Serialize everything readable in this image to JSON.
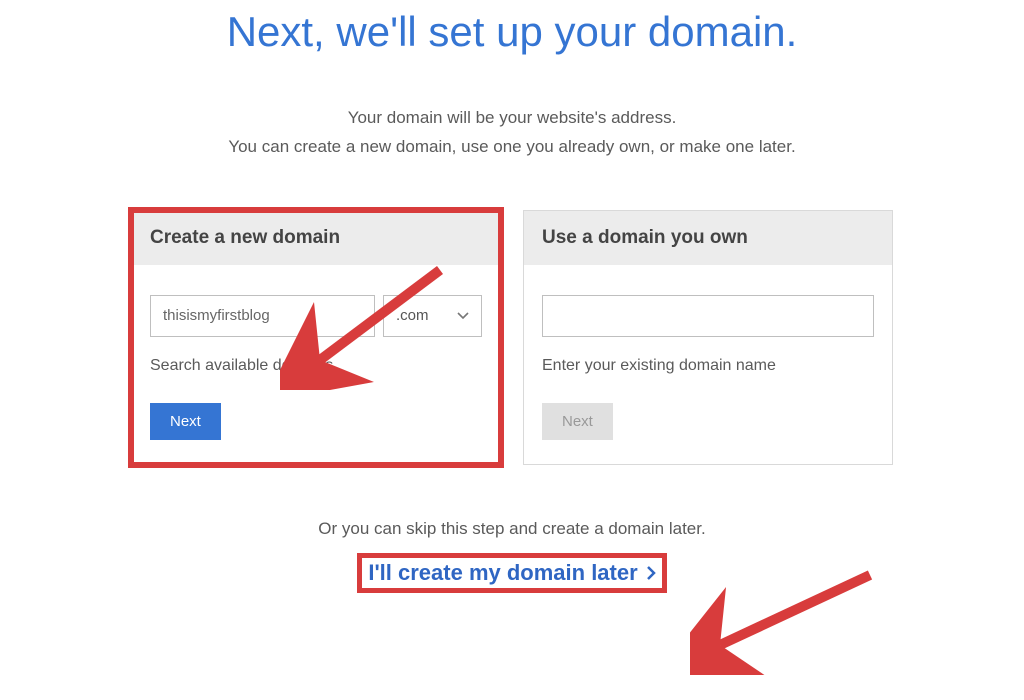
{
  "heading": "Next, we'll set up your domain.",
  "subheading_line1": "Your domain will be your website's address.",
  "subheading_line2": "You can create a new domain, use one you already own, or make one later.",
  "create_panel": {
    "title": "Create a new domain",
    "domain_value": "thisismyfirstblog",
    "tld_value": ".com",
    "helper": "Search available domains",
    "next_label": "Next"
  },
  "use_panel": {
    "title": "Use a domain you own",
    "domain_value": "",
    "helper": "Enter your existing domain name",
    "next_label": "Next"
  },
  "skip": {
    "prompt": "Or you can skip this step and create a domain later.",
    "link": "I'll create my domain later"
  }
}
